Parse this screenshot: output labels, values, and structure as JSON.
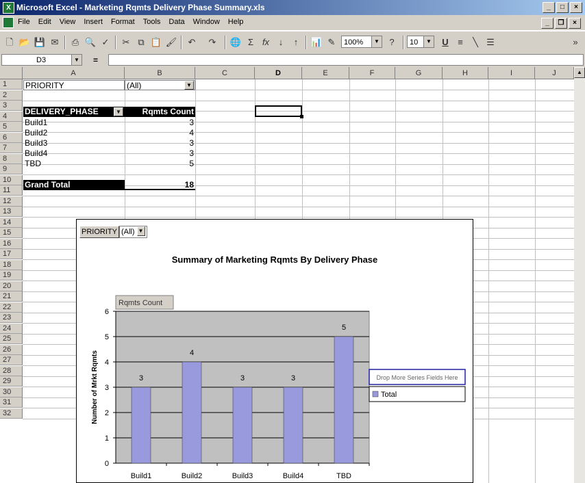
{
  "window": {
    "title": "Microsoft Excel - Marketing Rqmts Delivery Phase Summary.xls"
  },
  "menu": [
    "File",
    "Edit",
    "View",
    "Insert",
    "Format",
    "Tools",
    "Data",
    "Window",
    "Help"
  ],
  "toolbar": {
    "zoom": "100%",
    "font_size": "10"
  },
  "formula_bar": {
    "name_box": "D3",
    "eq": "="
  },
  "columns": [
    "A",
    "B",
    "C",
    "D",
    "E",
    "F",
    "G",
    "H",
    "I",
    "J"
  ],
  "rows": [
    "1",
    "2",
    "3",
    "4",
    "5",
    "6",
    "7",
    "8",
    "9",
    "10",
    "11",
    "12",
    "13",
    "14",
    "15",
    "16",
    "17",
    "18",
    "19",
    "20",
    "21",
    "22",
    "23",
    "24",
    "25",
    "26",
    "27",
    "28",
    "29",
    "30",
    "31",
    "32"
  ],
  "pivot": {
    "page_field": "PRIORITY",
    "page_value": "(All)",
    "row_field": "DELIVERY_PHASE",
    "data_field": "Rqmts Count",
    "items": [
      {
        "label": "Build1",
        "value": "3"
      },
      {
        "label": "Build2",
        "value": "4"
      },
      {
        "label": "Build3",
        "value": "3"
      },
      {
        "label": "Build4",
        "value": "3"
      },
      {
        "label": "TBD",
        "value": "5"
      }
    ],
    "grand_total_label": "Grand Total",
    "grand_total_value": "18"
  },
  "chart_pivot": {
    "field": "PRIORITY",
    "value": "(All)"
  },
  "chart_data": {
    "type": "bar",
    "title": "Summary of Marketing Rqmts By Delivery Phase",
    "ylabel": "Number of Mrkt Rqmts",
    "xlabel": "",
    "categories": [
      "Build1",
      "Build2",
      "Build3",
      "Build4",
      "TBD"
    ],
    "series": [
      {
        "name": "Total",
        "values": [
          3,
          4,
          3,
          3,
          5
        ]
      }
    ],
    "ylim": [
      0,
      6
    ],
    "yticks": [
      0,
      1,
      2,
      3,
      4,
      5,
      6
    ],
    "data_field_button": "Rqmts Count",
    "drop_series_text": "Drop More Series Fields Here",
    "legend": "right",
    "grid": true,
    "colors": {
      "bar": "#9999dd",
      "plot_bg": "#c0c0c0"
    }
  }
}
